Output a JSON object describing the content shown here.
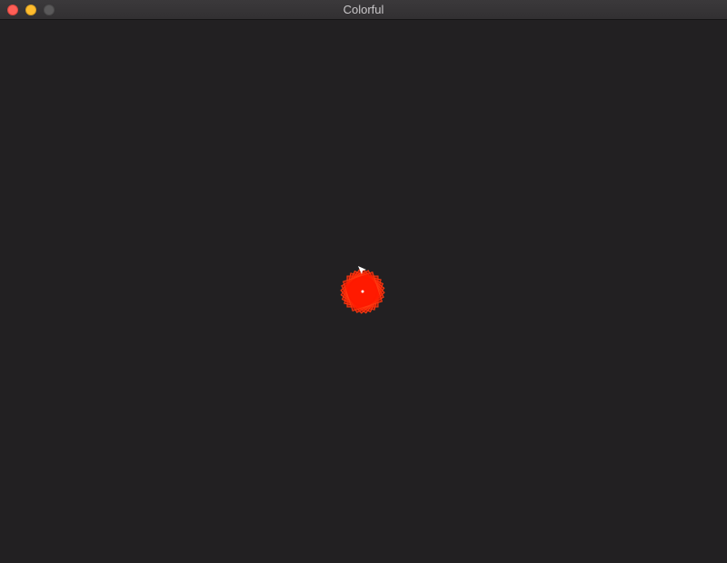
{
  "window": {
    "title": "Colorful",
    "controls": {
      "close_color": "#fe5f57",
      "minimize_color": "#febc2e",
      "zoom_color": "#5a595a"
    }
  },
  "canvas": {
    "background": "#222022",
    "shape_color": "#ff1a00",
    "shape_stroke": "#ff3a10",
    "cursor_color": "#ffffff",
    "center_dot_color": "#ffffff"
  }
}
